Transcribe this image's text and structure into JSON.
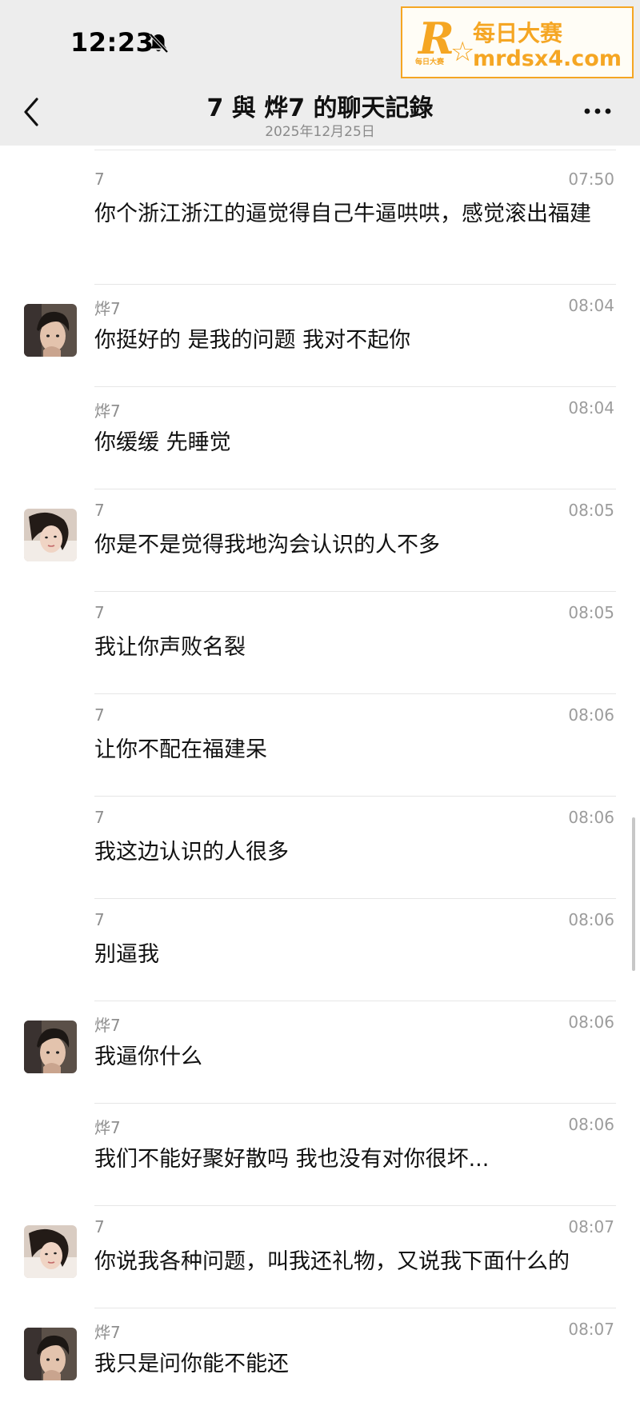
{
  "status_bar": {
    "time": "12:23",
    "mute_icon": "bell-slash-icon"
  },
  "watermark": {
    "logo_letter": "R",
    "logo_sub": "每日大赛",
    "title": "每日大赛",
    "url": "mrdsx4.com",
    "color": "#f5a623"
  },
  "header": {
    "back_icon": "chevron-left-icon",
    "title": "7 與 烨7 的聊天記錄",
    "subtitle": "2025年12月25日",
    "more_icon": "ellipsis-icon"
  },
  "messages": [
    {
      "sender": "7",
      "time": "07:50",
      "text": "你个浙江浙江的逼觉得自己牛逼哄哄，感觉滚出福建",
      "avatar": "none"
    },
    {
      "sender": "烨7",
      "time": "08:04",
      "text": "你挺好的 是我的问题 我对不起你",
      "avatar": "male"
    },
    {
      "sender": "烨7",
      "time": "08:04",
      "text": "你缓缓 先睡觉",
      "avatar": "none"
    },
    {
      "sender": "7",
      "time": "08:05",
      "text": "你是不是觉得我地沟会认识的人不多",
      "avatar": "female"
    },
    {
      "sender": "7",
      "time": "08:05",
      "text": "我让你声败名裂",
      "avatar": "none"
    },
    {
      "sender": "7",
      "time": "08:06",
      "text": "让你不配在福建呆",
      "avatar": "none"
    },
    {
      "sender": "7",
      "time": "08:06",
      "text": "我这边认识的人很多",
      "avatar": "none"
    },
    {
      "sender": "7",
      "time": "08:06",
      "text": "别逼我",
      "avatar": "none"
    },
    {
      "sender": "烨7",
      "time": "08:06",
      "text": "我逼你什么",
      "avatar": "male"
    },
    {
      "sender": "烨7",
      "time": "08:06",
      "text": "我们不能好聚好散吗 我也没有对你很坏...",
      "avatar": "none"
    },
    {
      "sender": "7",
      "time": "08:07",
      "text": "你说我各种问题，叫我还礼物，又说我下面什么的",
      "avatar": "female"
    },
    {
      "sender": "烨7",
      "time": "08:07",
      "text": "我只是问你能不能还",
      "avatar": "male"
    }
  ]
}
